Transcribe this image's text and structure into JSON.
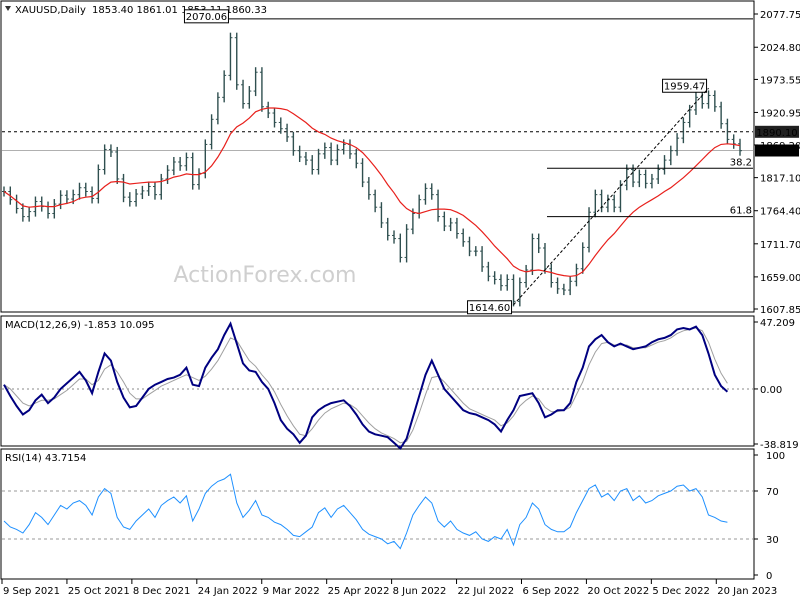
{
  "header": {
    "symbol": "XAUUSD,Daily",
    "ohlc": "1853.40 1861.01 1853.11 1860.33"
  },
  "watermark": "ActionForex.com",
  "colors": {
    "price": "#2f4f4f",
    "ma": "#e8201c",
    "macd": "#000080",
    "signal": "#a0a0a0",
    "rsi": "#1e90ff",
    "current_bg": "#000000",
    "level_bg": "#000000"
  },
  "chart_data": [
    {
      "type": "line",
      "panel": "price",
      "title": "XAUUSD,Daily",
      "ylim": [
        1607.85,
        2077.75
      ],
      "y_ticks": [
        "2077.75",
        "2024.80",
        "1973.55",
        "1920.95",
        "1869.20",
        "1817.10",
        "1764.40",
        "1711.70",
        "1659.00",
        "1607.85"
      ],
      "x_ticks": [
        "9 Sep 2021",
        "25 Oct 2021",
        "8 Dec 2021",
        "24 Jan 2022",
        "9 Mar 2022",
        "25 Apr 2022",
        "8 Jun 2022",
        "22 Jul 2022",
        "6 Sep 2022",
        "20 Oct 2022",
        "5 Dec 2022",
        "20 Jan 2023"
      ],
      "series": [
        {
          "values": [
            1795,
            1782,
            1768,
            1755,
            1763,
            1779,
            1771,
            1760,
            1775,
            1789,
            1783,
            1790,
            1801,
            1795,
            1784,
            1830,
            1862,
            1858,
            1815,
            1786,
            1779,
            1791,
            1796,
            1803,
            1790,
            1815,
            1829,
            1842,
            1836,
            1849,
            1806,
            1824,
            1870,
            1910,
            1945,
            1980,
            2040,
            1965,
            1935,
            1955,
            1985,
            1930,
            1920,
            1905,
            1895,
            1882,
            1860,
            1850,
            1845,
            1830,
            1855,
            1865,
            1845,
            1862,
            1870,
            1855,
            1840,
            1810,
            1790,
            1770,
            1745,
            1725,
            1720,
            1690,
            1735,
            1760,
            1782,
            1800,
            1790,
            1755,
            1740,
            1745,
            1728,
            1715,
            1700,
            1700,
            1675,
            1660,
            1655,
            1645,
            1655,
            1620,
            1650,
            1670,
            1720,
            1705,
            1672,
            1650,
            1640,
            1638,
            1652,
            1672,
            1706,
            1762,
            1790,
            1770,
            1782,
            1770,
            1805,
            1830,
            1810,
            1822,
            1808,
            1815,
            1830,
            1845,
            1860,
            1880,
            1905,
            1925,
            1945,
            1935,
            1948,
            1930,
            1903,
            1878,
            1871,
            1860
          ]
        },
        {
          "values": [
            1795,
            1788,
            1780,
            1772,
            1770,
            1771,
            1772,
            1771,
            1771,
            1774,
            1776,
            1779,
            1784,
            1786,
            1787,
            1794,
            1803,
            1810,
            1811,
            1810,
            1807,
            1808,
            1809,
            1810,
            1810,
            1811,
            1814,
            1818,
            1820,
            1823,
            1822,
            1822,
            1826,
            1836,
            1850,
            1867,
            1887,
            1898,
            1904,
            1912,
            1922,
            1926,
            1928,
            1928,
            1927,
            1925,
            1919,
            1912,
            1905,
            1896,
            1890,
            1886,
            1880,
            1876,
            1873,
            1870,
            1865,
            1857,
            1846,
            1834,
            1821,
            1806,
            1793,
            1778,
            1768,
            1762,
            1760,
            1763,
            1766,
            1767,
            1767,
            1766,
            1762,
            1757,
            1749,
            1741,
            1731,
            1720,
            1708,
            1698,
            1688,
            1676,
            1670,
            1667,
            1669,
            1670,
            1668,
            1666,
            1663,
            1661,
            1660,
            1661,
            1667,
            1679,
            1693,
            1706,
            1718,
            1728,
            1740,
            1752,
            1762,
            1770,
            1776,
            1782,
            1788,
            1795,
            1801,
            1809,
            1817,
            1826,
            1836,
            1846,
            1856,
            1865,
            1870,
            1871,
            1870,
            1868
          ]
        }
      ],
      "annotations": [
        {
          "text": "2070.06",
          "value": 2070.06,
          "type": "high-label"
        },
        {
          "text": "1959.47",
          "value": 1959.47,
          "type": "high-label"
        },
        {
          "text": "1614.60",
          "value": 1614.6,
          "type": "low-label"
        },
        {
          "text": "38.2",
          "value": 1832,
          "type": "fib-level"
        },
        {
          "text": "61.8",
          "value": 1755,
          "type": "fib-level"
        },
        {
          "text": "1890.10",
          "value": 1890.1,
          "type": "level-tag"
        },
        {
          "text": "1860.33",
          "value": 1860.33,
          "type": "current-price-tag"
        }
      ]
    },
    {
      "type": "line",
      "panel": "macd",
      "title": "MACD(12,26,9) -1.853 10.095",
      "ylim": [
        -38.819,
        47.209
      ],
      "y_ticks": [
        "47.209",
        "0.00",
        "-38.819"
      ],
      "series": [
        {
          "values": [
            3,
            -5,
            -12,
            -18,
            -15,
            -8,
            -4,
            -10,
            -6,
            0,
            4,
            8,
            12,
            6,
            -3,
            12,
            25,
            20,
            5,
            -6,
            -13,
            -12,
            -6,
            0,
            3,
            5,
            7,
            8,
            10,
            15,
            3,
            2,
            15,
            22,
            28,
            38,
            46,
            32,
            18,
            13,
            12,
            5,
            0,
            -10,
            -22,
            -28,
            -32,
            -38,
            -33,
            -20,
            -15,
            -12,
            -10,
            -9,
            -8,
            -12,
            -18,
            -25,
            -30,
            -32,
            -33,
            -34,
            -38,
            -42,
            -35,
            -20,
            -5,
            10,
            20,
            10,
            0,
            -5,
            -10,
            -15,
            -17,
            -18,
            -20,
            -22,
            -25,
            -30,
            -22,
            -15,
            -5,
            -4,
            -3,
            -10,
            -20,
            -18,
            -15,
            -15,
            -10,
            5,
            15,
            30,
            35,
            38,
            33,
            30,
            32,
            30,
            28,
            29,
            30,
            33,
            35,
            36,
            38,
            42,
            43,
            42,
            44,
            38,
            25,
            10,
            2,
            -2
          ]
        },
        {
          "values": [
            3,
            0,
            -5,
            -10,
            -12,
            -10,
            -8,
            -8,
            -7,
            -4,
            -1,
            3,
            7,
            7,
            3,
            6,
            14,
            17,
            12,
            5,
            -3,
            -7,
            -7,
            -4,
            -1,
            2,
            4,
            6,
            8,
            10,
            8,
            6,
            9,
            14,
            20,
            28,
            36,
            34,
            27,
            20,
            16,
            10,
            5,
            -2,
            -11,
            -19,
            -26,
            -32,
            -33,
            -28,
            -22,
            -17,
            -14,
            -12,
            -10,
            -11,
            -14,
            -19,
            -24,
            -28,
            -31,
            -33,
            -35,
            -38,
            -37,
            -29,
            -17,
            -4,
            8,
            9,
            5,
            0,
            -5,
            -10,
            -14,
            -16,
            -18,
            -20,
            -22,
            -26,
            -24,
            -19,
            -12,
            -8,
            -5,
            -7,
            -13,
            -16,
            -16,
            -15,
            -13,
            -4,
            5,
            17,
            26,
            32,
            33,
            31,
            31,
            31,
            29,
            29,
            29,
            31,
            33,
            34,
            36,
            39,
            41,
            42,
            43,
            41,
            33,
            21,
            11,
            4
          ]
        }
      ]
    },
    {
      "type": "line",
      "panel": "rsi",
      "title": "RSI(14) 43.7154",
      "ylim": [
        0,
        100
      ],
      "y_ticks": [
        "100",
        "70",
        "30",
        "0"
      ],
      "reference_lines": [
        70,
        30
      ],
      "series": [
        {
          "values": [
            45,
            40,
            38,
            35,
            42,
            52,
            48,
            42,
            50,
            58,
            55,
            60,
            62,
            58,
            50,
            65,
            72,
            68,
            48,
            40,
            38,
            45,
            50,
            55,
            48,
            58,
            62,
            65,
            60,
            66,
            45,
            55,
            68,
            74,
            78,
            80,
            84,
            60,
            48,
            54,
            62,
            50,
            48,
            44,
            42,
            38,
            33,
            32,
            36,
            40,
            52,
            56,
            48,
            55,
            58,
            52,
            46,
            38,
            34,
            32,
            30,
            26,
            28,
            22,
            35,
            50,
            58,
            65,
            60,
            45,
            40,
            45,
            38,
            35,
            33,
            36,
            30,
            28,
            32,
            30,
            38,
            25,
            42,
            48,
            60,
            55,
            42,
            38,
            36,
            36,
            40,
            52,
            62,
            72,
            75,
            65,
            68,
            62,
            70,
            72,
            62,
            66,
            60,
            62,
            66,
            68,
            70,
            74,
            75,
            70,
            72,
            65,
            50,
            48,
            45,
            44
          ]
        }
      ]
    }
  ],
  "macd_label": "MACD(12,26,9) -1.853 10.095",
  "rsi_label": "RSI(14) 43.7154",
  "price_axis": {
    "ticks": [
      "2077.75",
      "2024.80",
      "1973.55",
      "1920.95",
      "1869.20",
      "1817.10",
      "1764.40",
      "1711.70",
      "1659.00",
      "1607.85"
    ]
  },
  "macd_axis": {
    "ticks": [
      "47.209",
      "0.00",
      "-38.819"
    ]
  },
  "rsi_axis": {
    "ticks": [
      "100",
      "70",
      "30",
      "0"
    ]
  },
  "date_axis": {
    "ticks": [
      "9 Sep 2021",
      "25 Oct 2021",
      "8 Dec 2021",
      "24 Jan 2022",
      "9 Mar 2022",
      "25 Apr 2022",
      "8 Jun 2022",
      "22 Jul 2022",
      "6 Sep 2022",
      "20 Oct 2022",
      "5 Dec 2022",
      "20 Jan 2023"
    ]
  }
}
